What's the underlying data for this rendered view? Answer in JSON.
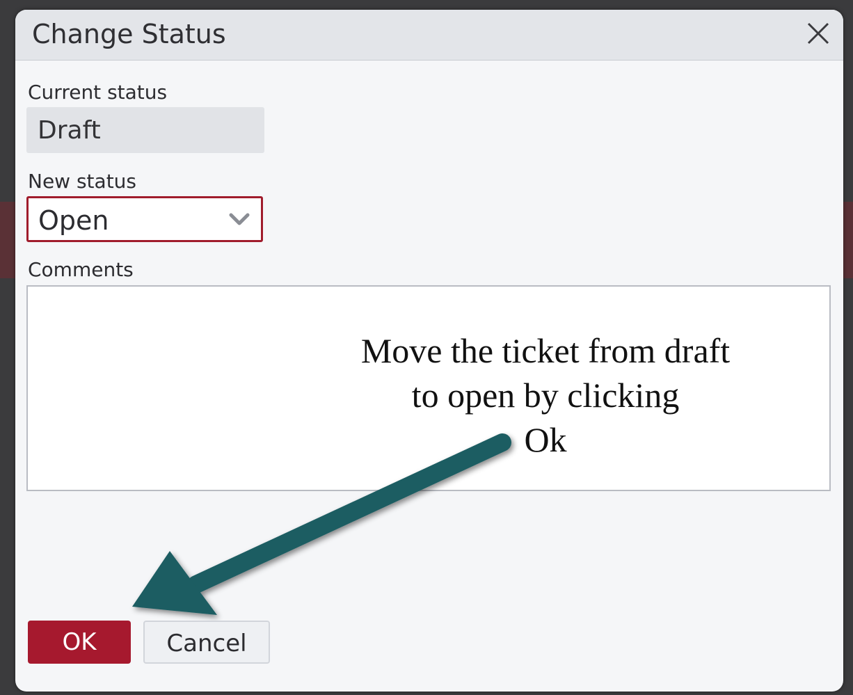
{
  "dialog": {
    "title": "Change Status",
    "close_icon": "close-icon"
  },
  "fields": {
    "current_status_label": "Current status",
    "current_status_value": "Draft",
    "new_status_label": "New status",
    "new_status_value": "Open",
    "comments_label": "Comments",
    "comments_value": ""
  },
  "annotation": {
    "text_line1": "Move the ticket from draft",
    "text_line2": "to open by clicking",
    "text_line3": "Ok"
  },
  "buttons": {
    "ok_label": "OK",
    "cancel_label": "Cancel"
  },
  "colors": {
    "accent": "#a6192e",
    "arrow": "#1f5d62"
  }
}
